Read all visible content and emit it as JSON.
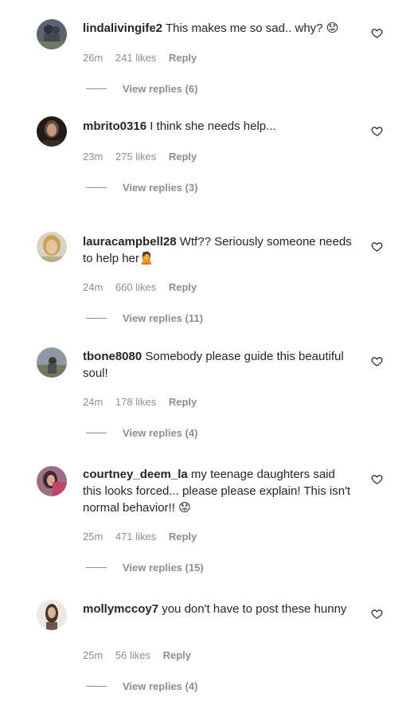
{
  "comments": [
    {
      "username": "lindalivingife2",
      "text": "This makes me so sad.. why?",
      "emoji": "😟",
      "time": "26m",
      "likes": "241 likes",
      "reply": "Reply",
      "view_replies": "View replies (6)"
    },
    {
      "username": "mbrito0316",
      "text": "I think she needs help...",
      "emoji": "",
      "time": "23m",
      "likes": "275 likes",
      "reply": "Reply",
      "view_replies": "View replies (3)"
    },
    {
      "username": "lauracampbell28",
      "text": "Wtf?? Seriously someone needs to help her",
      "emoji": "🙎",
      "time": "24m",
      "likes": "660 likes",
      "reply": "Reply",
      "view_replies": "View replies (11)"
    },
    {
      "username": "tbone8080",
      "text": "Somebody please guide this beautiful soul!",
      "emoji": "",
      "time": "24m",
      "likes": "178 likes",
      "reply": "Reply",
      "view_replies": "View replies (4)"
    },
    {
      "username": "courtney_deem_la",
      "text": "my teenage daughters said this looks forced... please please explain! This isn't normal behavior!!",
      "emoji": "😟",
      "time": "25m",
      "likes": "471 likes",
      "reply": "Reply",
      "view_replies": "View replies (15)"
    },
    {
      "username": "mollymccoy7",
      "text": "you don't have to post these hunny",
      "emoji": "",
      "time": "25m",
      "likes": "56 likes",
      "reply": "Reply",
      "view_replies": "View replies (4)"
    }
  ],
  "icons": {
    "like": "heart-outline-icon"
  },
  "colors": {
    "text": "#262626",
    "muted": "#8e8e8e",
    "background": "#ffffff"
  }
}
